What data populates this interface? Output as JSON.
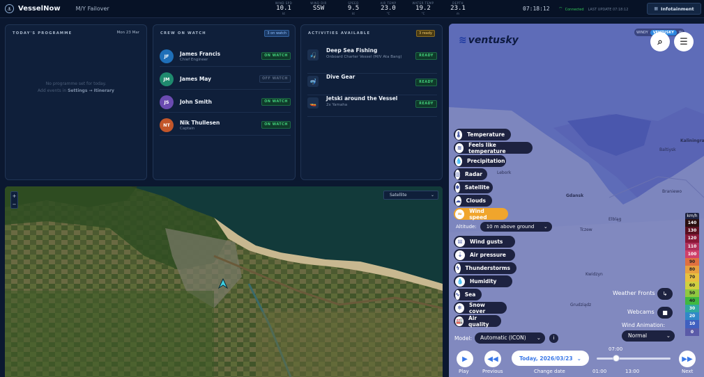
{
  "topbar": {
    "logo_glyph": "⚓",
    "app_name": "VesselNow",
    "vessel": "M/Y Failover",
    "metrics": [
      {
        "label": "WIND SPD",
        "value": "10.1",
        "unit": "kt"
      },
      {
        "label": "WIND DIR",
        "value": "SSW",
        "unit": ""
      },
      {
        "label": "SPEED",
        "value": "9.5",
        "unit": "kt"
      },
      {
        "label": "AIR TEMP",
        "value": "23.0",
        "unit": "°C"
      },
      {
        "label": "WATER TEMP",
        "value": "19.2",
        "unit": "°C"
      },
      {
        "label": "DEPTH",
        "value": "23.1",
        "unit": "m"
      }
    ],
    "clock": "07:18:12",
    "connection": "Connected",
    "last_update": "LAST UPDATE 07:18:12",
    "infotainment": "Infotainment"
  },
  "programme": {
    "title": "TODAY'S PROGRAMME",
    "date": "Mon 23 Mar",
    "empty_line1": "No programme set for today.",
    "empty_line2_prefix": "Add events in ",
    "empty_line2_link": "Settings → Itinerary"
  },
  "crew": {
    "title": "CREW ON WATCH",
    "badge": "3 on watch",
    "members": [
      {
        "initials": "JF",
        "name": "James Francis",
        "role": "Chief Engineer",
        "status": "ON WATCH",
        "color": "#1f6fb8"
      },
      {
        "initials": "JM",
        "name": "James May",
        "role": "",
        "status": "OFF WATCH",
        "color": "#1f8a6e"
      },
      {
        "initials": "JS",
        "name": "John Smith",
        "role": "",
        "status": "ON WATCH",
        "color": "#6a4bb0"
      },
      {
        "initials": "NT",
        "name": "Nik Thullesen",
        "role": "Captain",
        "status": "ON WATCH",
        "color": "#c2562a"
      }
    ]
  },
  "activities": {
    "title": "ACTIVITIES AVAILABLE",
    "badge": "3 ready",
    "items": [
      {
        "name": "Deep Sea Fishing",
        "sub": "Onboard Charter Vessel (M/V Ata Bang)",
        "status": "READY",
        "icon": "fishing-icon",
        "glyph": "🎣"
      },
      {
        "name": "Dive Gear",
        "sub": "",
        "status": "READY",
        "icon": "diving-icon",
        "glyph": "🤿"
      },
      {
        "name": "Jetski around the Vessel",
        "sub": "2x Yamaha",
        "status": "READY",
        "icon": "jetski-icon",
        "glyph": "🚤"
      }
    ]
  },
  "map": {
    "zoom_in": "+",
    "zoom_out": "−",
    "layer": "Satellite"
  },
  "ventusky": {
    "brand": "ventusky",
    "source_windy": "WINDY",
    "source_ventusky": "VENTUSKY",
    "source_other": "W",
    "search_glyph": "⌕",
    "menu_glyph": "☰",
    "cities": [
      "Lebork",
      "Gdansk",
      "Tczew",
      "Elbląg",
      "Kwidzyn",
      "Grudziądz",
      "Baltiysk",
      "Braniewo",
      "Kaliningrad"
    ],
    "layers": [
      {
        "label": "Temperature",
        "glyph": "🌡"
      },
      {
        "label": "Feels like temperature",
        "glyph": "≋"
      },
      {
        "label": "Precipitation",
        "glyph": "💧"
      },
      {
        "label": "Radar",
        "glyph": "◎"
      },
      {
        "label": "Satellite",
        "glyph": "✱"
      },
      {
        "label": "Clouds",
        "glyph": "☁"
      },
      {
        "label": "Wind speed",
        "glyph": "≈"
      },
      {
        "label": "Wind gusts",
        "glyph": "𝍐"
      },
      {
        "label": "Air pressure",
        "glyph": "⇣"
      },
      {
        "label": "Thunderstorms",
        "glyph": "ϟ"
      },
      {
        "label": "Humidity",
        "glyph": "💧"
      },
      {
        "label": "Sea",
        "glyph": "∿"
      },
      {
        "label": "Snow cover",
        "glyph": "❄"
      },
      {
        "label": "Air quality",
        "glyph": "🏭"
      }
    ],
    "active_layer": "Wind speed",
    "altitude_label": "Altitude:",
    "altitude_value": "10 m above ground",
    "legend_unit": "km/h",
    "legend": [
      {
        "v": "140",
        "c": "#2a1010",
        "t": "#fff"
      },
      {
        "v": "130",
        "c": "#5a1020",
        "t": "#fff"
      },
      {
        "v": "120",
        "c": "#8a1838",
        "t": "#fff"
      },
      {
        "v": "110",
        "c": "#b0305a",
        "t": "#fff"
      },
      {
        "v": "100",
        "c": "#d0406a",
        "t": "#fff"
      },
      {
        "v": "90",
        "c": "#e07040",
        "t": "#222"
      },
      {
        "v": "80",
        "c": "#e8a040",
        "t": "#222"
      },
      {
        "v": "70",
        "c": "#e8c040",
        "t": "#222"
      },
      {
        "v": "60",
        "c": "#d0d040",
        "t": "#222"
      },
      {
        "v": "50",
        "c": "#90c840",
        "t": "#222"
      },
      {
        "v": "40",
        "c": "#40b840",
        "t": "#222"
      },
      {
        "v": "30",
        "c": "#30a8a0",
        "t": "#fff"
      },
      {
        "v": "20",
        "c": "#3088c8",
        "t": "#fff"
      },
      {
        "v": "10",
        "c": "#4060c0",
        "t": "#fff"
      },
      {
        "v": "0",
        "c": "#5a5aa8",
        "t": "#fff"
      }
    ],
    "weather_fronts": "Weather Fronts",
    "webcams": "Webcams",
    "wind_animation_label": "Wind Animation:",
    "wind_animation_value": "Normal",
    "model_label": "Model:",
    "model_value": "Automatic (ICON)",
    "play": "Play",
    "previous": "Previous",
    "date": "Today, 2026/03/23",
    "change_date": "Change date",
    "time_now": "07:00",
    "t1": "01:00",
    "t2": "13:00",
    "next": "Next"
  }
}
